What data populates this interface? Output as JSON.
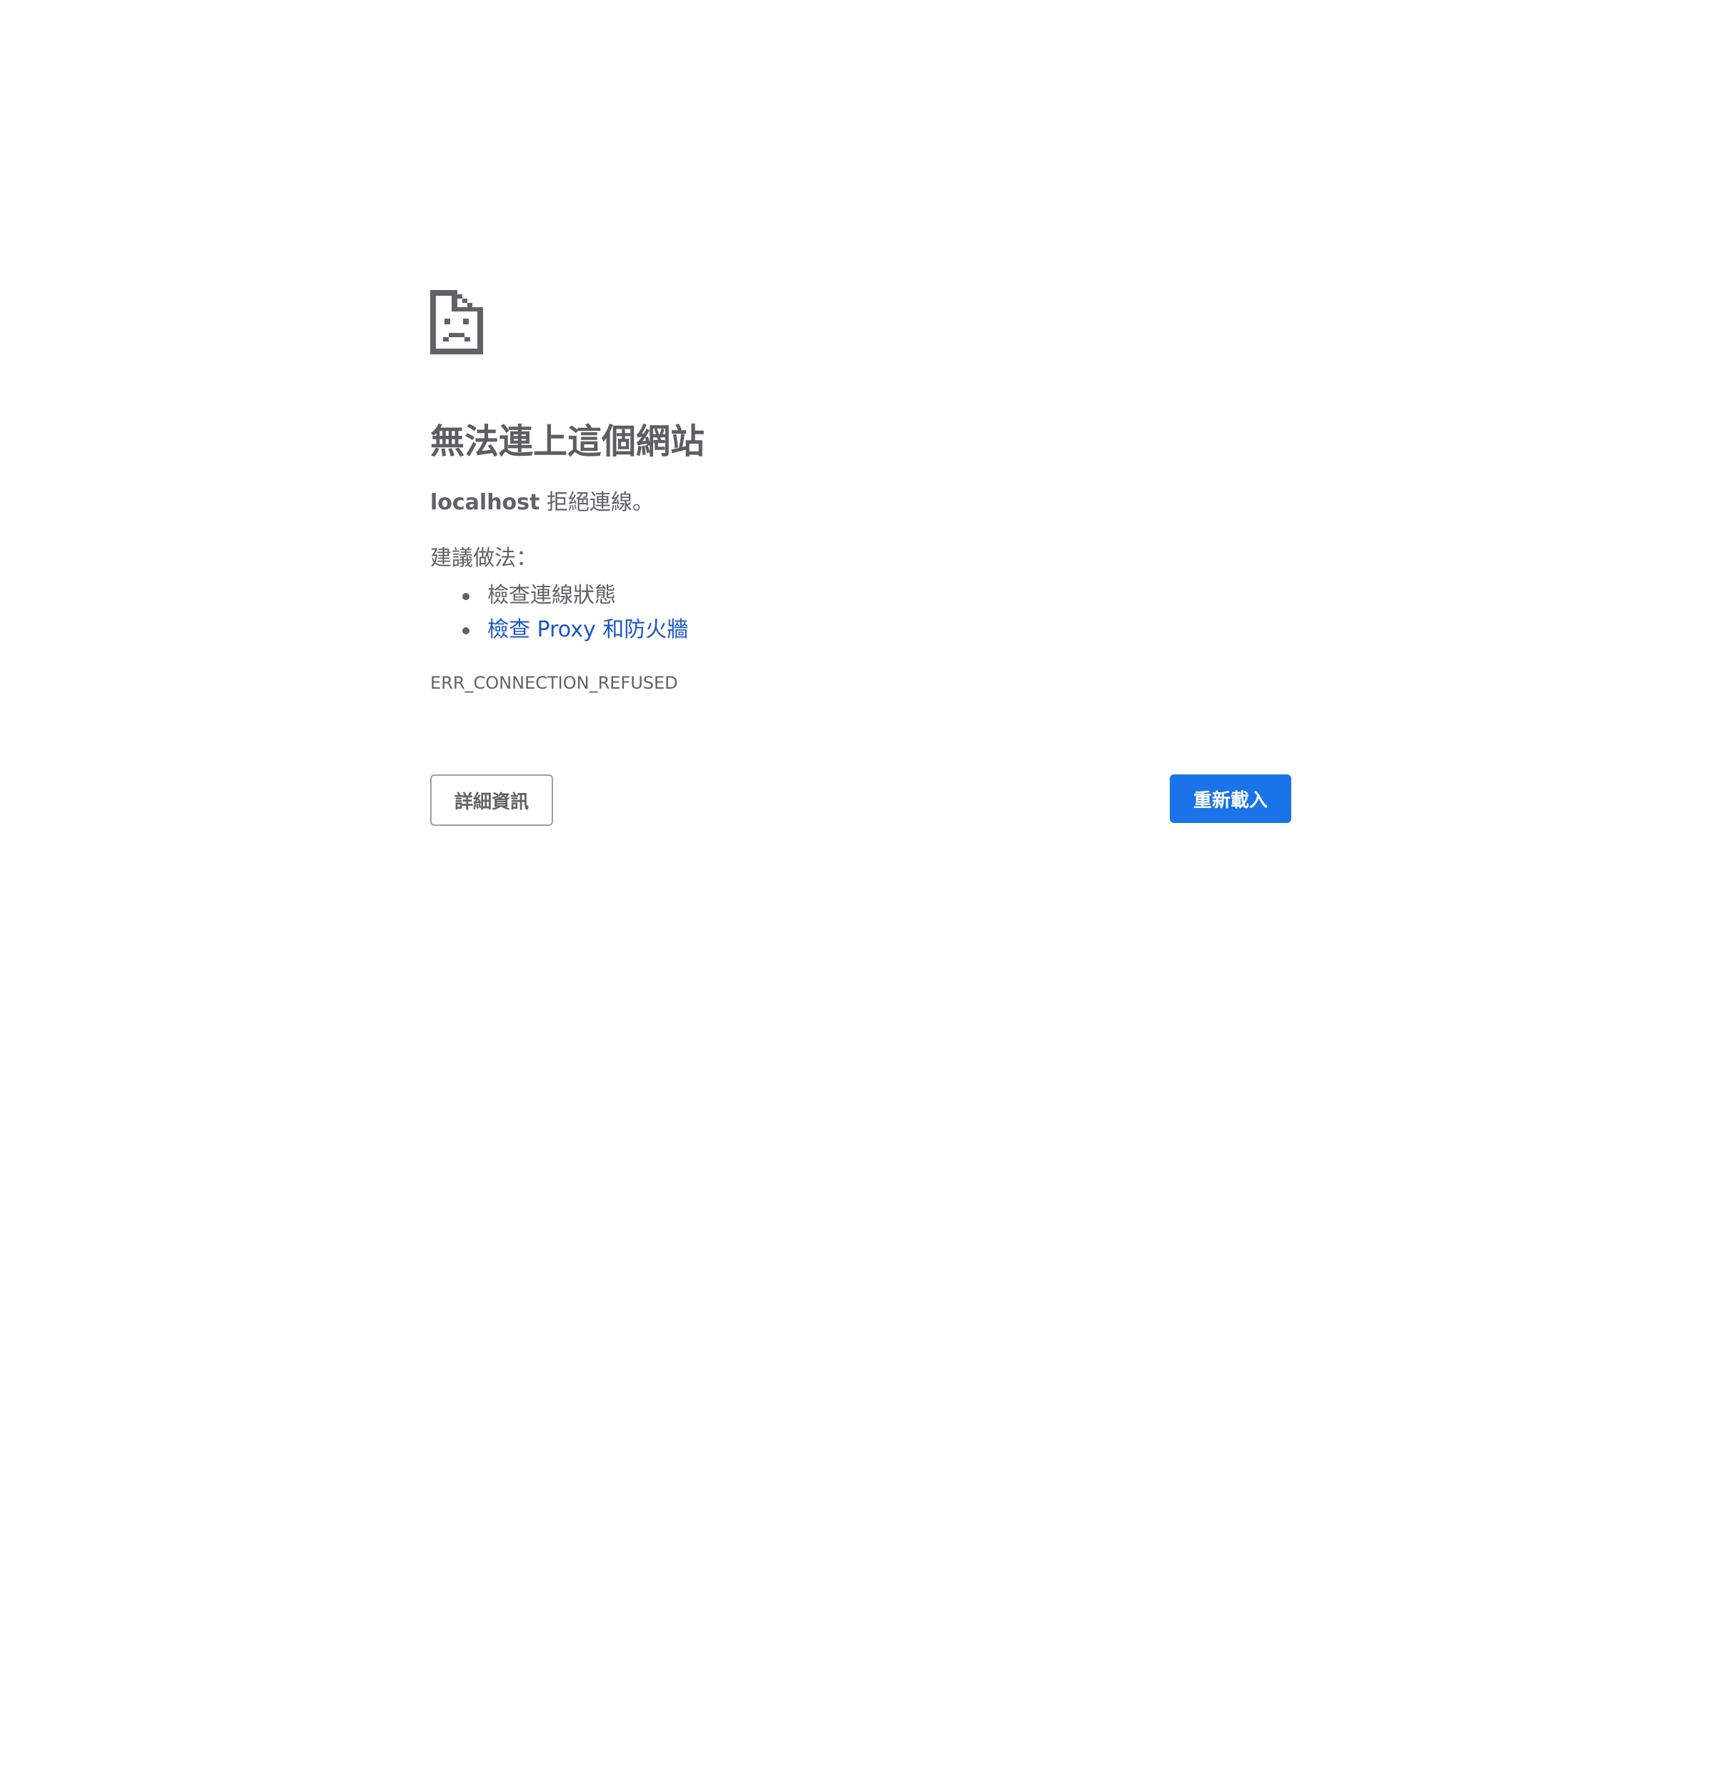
{
  "error_page": {
    "icon": "sad-document-icon",
    "title": "無法連上這個網站",
    "message": {
      "host": "localhost",
      "text": " 拒絕連線。"
    },
    "suggestions_heading": "建議做法：",
    "suggestions": [
      {
        "label": "檢查連線狀態",
        "is_link": false
      },
      {
        "label": "檢查 Proxy 和防火牆",
        "is_link": true
      }
    ],
    "error_code": "ERR_CONNECTION_REFUSED",
    "buttons": {
      "details_label": "詳細資訊",
      "reload_label": "重新載入"
    }
  },
  "colors": {
    "text": "#5f6368",
    "link": "#1a56c8",
    "primary_button": "#1a73e8"
  }
}
